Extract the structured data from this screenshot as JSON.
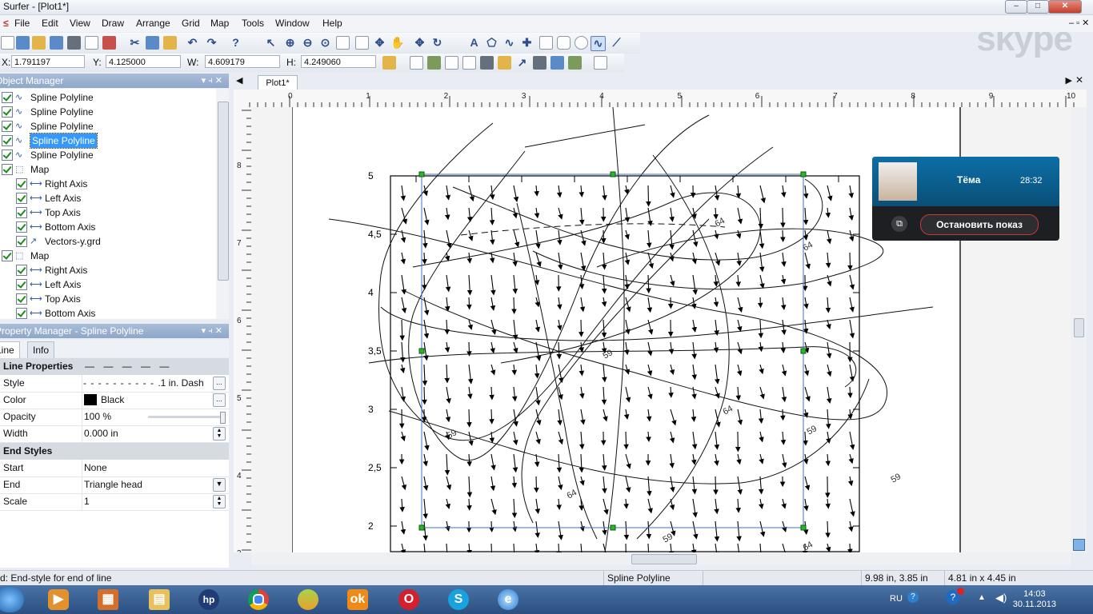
{
  "window": {
    "title": "Surfer - [Plot1*]"
  },
  "watermark": {
    "text": "skype"
  },
  "menu": [
    "File",
    "Edit",
    "View",
    "Draw",
    "Arrange",
    "Grid",
    "Map",
    "Tools",
    "Window",
    "Help"
  ],
  "coords": {
    "x_label": "X:",
    "x": "1.791197",
    "y_label": "Y:",
    "y": "4.125000",
    "w_label": "W:",
    "w": "4.609179",
    "h_label": "H:",
    "h": "4.249060"
  },
  "object_manager": {
    "title": "Object Manager",
    "items": [
      {
        "label": "Spline Polyline",
        "depth": 0,
        "selected": false,
        "icon": "spline-icon"
      },
      {
        "label": "Spline Polyline",
        "depth": 0,
        "selected": false,
        "icon": "spline-icon"
      },
      {
        "label": "Spline Polyline",
        "depth": 0,
        "selected": false,
        "icon": "spline-icon"
      },
      {
        "label": "Spline Polyline",
        "depth": 0,
        "selected": true,
        "icon": "spline-icon"
      },
      {
        "label": "Spline Polyline",
        "depth": 0,
        "selected": false,
        "icon": "spline-icon"
      },
      {
        "label": "Map",
        "depth": 0,
        "selected": false,
        "icon": "map-frame-icon"
      },
      {
        "label": "Right Axis",
        "depth": 1,
        "selected": false,
        "icon": "axis-icon"
      },
      {
        "label": "Left Axis",
        "depth": 1,
        "selected": false,
        "icon": "axis-icon"
      },
      {
        "label": "Top Axis",
        "depth": 1,
        "selected": false,
        "icon": "axis-icon"
      },
      {
        "label": "Bottom Axis",
        "depth": 1,
        "selected": false,
        "icon": "axis-icon"
      },
      {
        "label": "Vectors-y.grd",
        "depth": 1,
        "selected": false,
        "icon": "vector-icon"
      },
      {
        "label": "Map",
        "depth": 0,
        "selected": false,
        "icon": "map-frame-icon"
      },
      {
        "label": "Right Axis",
        "depth": 1,
        "selected": false,
        "icon": "axis-icon"
      },
      {
        "label": "Left Axis",
        "depth": 1,
        "selected": false,
        "icon": "axis-icon"
      },
      {
        "label": "Top Axis",
        "depth": 1,
        "selected": false,
        "icon": "axis-icon"
      },
      {
        "label": "Bottom Axis",
        "depth": 1,
        "selected": false,
        "icon": "axis-icon"
      }
    ]
  },
  "property_manager": {
    "title": "Property Manager - Spline Polyline",
    "tabs": [
      "Line",
      "Info"
    ],
    "line_section": "Line Properties",
    "rows": [
      {
        "key": "Style",
        "value": ".1 in. Dash"
      },
      {
        "key": "Color",
        "value": "Black"
      },
      {
        "key": "Opacity",
        "value": "100 %"
      },
      {
        "key": "Width",
        "value": "0.000 in"
      }
    ],
    "end_section": "End Styles",
    "end_rows": [
      {
        "key": "Start",
        "value": "None"
      },
      {
        "key": "End",
        "value": "Triangle head"
      },
      {
        "key": "Scale",
        "value": "1"
      }
    ]
  },
  "document": {
    "tab": "Plot1*"
  },
  "ruler": {
    "h_labels": [
      "0",
      "1",
      "2",
      "3",
      "4",
      "5",
      "6",
      "7",
      "8",
      "9",
      "10"
    ],
    "v_labels": [
      "8",
      "7",
      "6",
      "5",
      "4",
      "3"
    ]
  },
  "plot": {
    "y_ticks": [
      "5",
      "4,5",
      "4",
      "3,5",
      "3",
      "2,5",
      "2"
    ],
    "contour_labels": [
      "64",
      "59",
      "59",
      "64",
      "59",
      "64",
      "59",
      "64",
      "64",
      "59"
    ]
  },
  "skype_call": {
    "name": "Тёма",
    "duration": "28:32",
    "button": "Остановить показ"
  },
  "status": {
    "message": "d: End-style for end of line",
    "object": "Spline Polyline",
    "position": "9.98 in, 3.85 in",
    "size": "4.81 in x 4.45 in"
  },
  "taskbar": {
    "lang": "RU",
    "time": "14:03",
    "date": "30.11.2013"
  }
}
